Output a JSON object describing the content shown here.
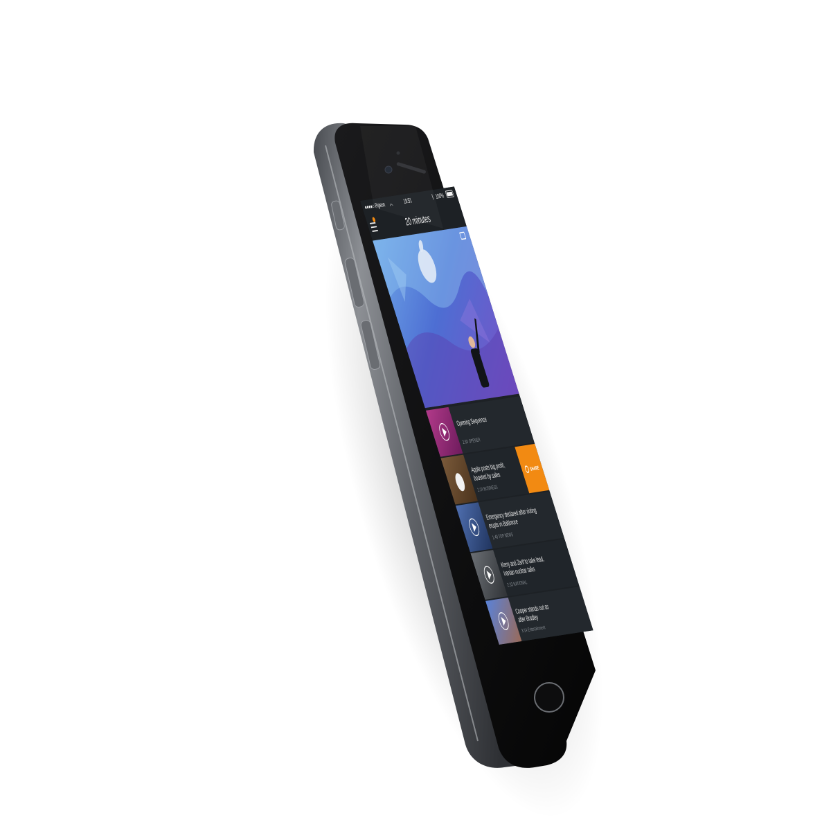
{
  "status_bar": {
    "carrier": "●●●●○ Pigeon",
    "time": "18:51",
    "battery": "100%"
  },
  "header": {
    "title": "20 minutes"
  },
  "list": [
    {
      "title_line1": "Opening Sequence",
      "title_line2": "",
      "meta": "2:30   OPENER"
    },
    {
      "title_line1": "Apple posts big profit,",
      "title_line2": "boosted by sales",
      "meta": "1:14   BUSINESS"
    },
    {
      "title_line1": "Emergency declared after rioting",
      "title_line2": "erupts in Baltimore",
      "meta": "1:40   TOP NEWS"
    },
    {
      "title_line1": "Kerry and Zarif to take lead,",
      "title_line2": "Iranian nuclear talks",
      "meta": "2:33   NATIONAL"
    },
    {
      "title_line1": "Cooper stands out as",
      "title_line2": "after Bradley",
      "meta": "3:14   Entertainment"
    }
  ],
  "share": {
    "label": "SHARE"
  },
  "colors": {
    "accent": "#f28a12",
    "screen_bg": "#1d2125",
    "row_bg": "#23282d",
    "hero_blue": "#3a63c4",
    "hero_purple": "#6a4fc0"
  }
}
